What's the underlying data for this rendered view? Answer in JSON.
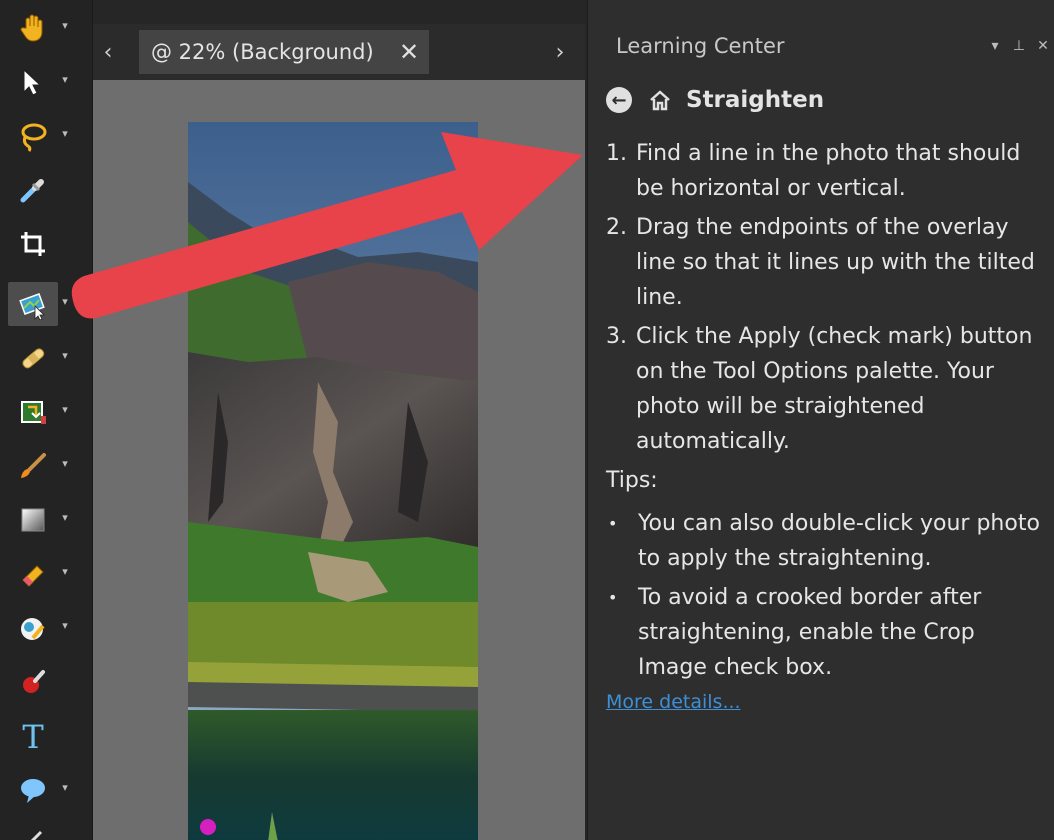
{
  "toolbar": {
    "tools": [
      {
        "name": "pan-tool",
        "icon": "hand-icon",
        "has_flyout": true
      },
      {
        "name": "pick-tool",
        "icon": "arrow-pointer-icon",
        "has_flyout": true
      },
      {
        "name": "selection-tool",
        "icon": "lasso-icon",
        "has_flyout": true
      },
      {
        "name": "dropper-tool",
        "icon": "eyedropper-icon",
        "has_flyout": false
      },
      {
        "name": "crop-tool",
        "icon": "crop-icon",
        "has_flyout": false
      },
      {
        "name": "straighten-tool",
        "icon": "straighten-icon",
        "has_flyout": true,
        "active": true
      },
      {
        "name": "red-eye-tool",
        "icon": "bandage-icon",
        "has_flyout": true
      },
      {
        "name": "makeover-tool",
        "icon": "fill-icon",
        "has_flyout": true
      },
      {
        "name": "paint-brush-tool",
        "icon": "paint-brush-icon",
        "has_flyout": true
      },
      {
        "name": "gradient-tool",
        "icon": "gradient-icon",
        "has_flyout": true
      },
      {
        "name": "eraser-tool",
        "icon": "eraser-icon",
        "has_flyout": true
      },
      {
        "name": "color-replacer-tool",
        "icon": "color-replacer-icon",
        "has_flyout": true
      },
      {
        "name": "pin-tool",
        "icon": "pin-icon",
        "has_flyout": false
      },
      {
        "name": "text-tool",
        "icon": "text-icon",
        "has_flyout": false
      },
      {
        "name": "shape-tool",
        "icon": "speech-bubble-icon",
        "has_flyout": true
      }
    ]
  },
  "document": {
    "tab_label": "@ 22% (Background)",
    "tab_close": "✕",
    "prev_glyph": "‹",
    "next_glyph": "›"
  },
  "learning_center": {
    "title": "Learning Center",
    "topic": "Straighten",
    "steps": [
      {
        "num": "1.",
        "text": "Find a line in the photo that should be horizontal or vertical."
      },
      {
        "num": "2.",
        "text": "Drag the endpoints of the overlay line so that it lines up with the tilted line."
      },
      {
        "num": "3.",
        "text": "Click the Apply (check mark) button on the Tool Options palette. Your photo will be straightened automatically."
      }
    ],
    "tips_heading": "Tips:",
    "tips": [
      {
        "bullet": "•",
        "text": "You can also double-click your photo to apply the straightening."
      },
      {
        "bullet": "•",
        "text": "To avoid a crooked border after straightening, enable the Crop Image check box."
      }
    ],
    "more_details": "More details..."
  },
  "colors": {
    "arrow": "#e8424a",
    "link": "#3f8fd6",
    "panel_bg": "#2e2e2e",
    "canvas_bg": "#6e6e6e"
  }
}
